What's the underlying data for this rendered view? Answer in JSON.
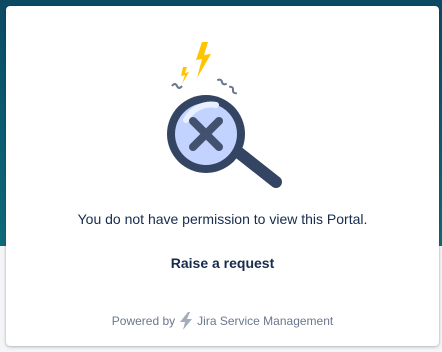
{
  "message": "You do not have permission to view this Portal.",
  "raise_request_label": "Raise a request",
  "footer": {
    "powered_by_label": "Powered by",
    "product_name": "Jira Service Management"
  },
  "colors": {
    "banner": "#0c4a63",
    "text": "#172b4d",
    "muted": "#6b778c",
    "magnifier_ring": "#344563",
    "lightning": "#ffc400"
  },
  "icons": {
    "illustration": "no-access-magnifier-icon",
    "product": "jira-service-management-icon"
  }
}
